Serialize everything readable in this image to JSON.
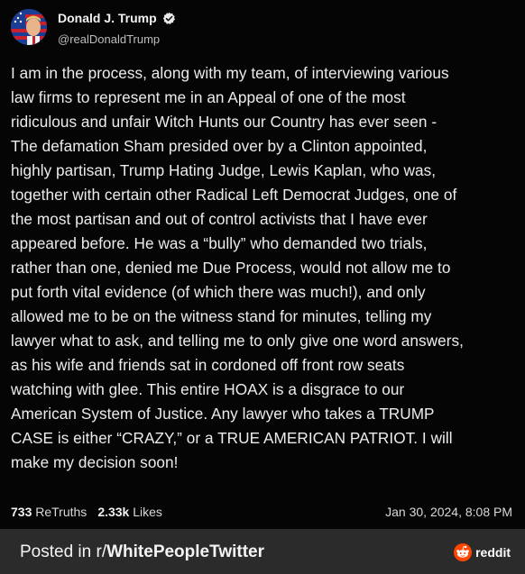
{
  "author": {
    "display_name": "Donald J. Trump",
    "handle": "@realDonaldTrump",
    "avatar_icon": "avatar-flag-portrait-icon",
    "verified_icon": "verified-badge-icon"
  },
  "post": {
    "text": "I am in the process, along with my team, of interviewing various\nlaw firms to represent me in an Appeal of one of the most\nridiculous and unfair Witch Hunts our Country has ever seen -\nThe defamation Sham presided over by a Clinton appointed,\nhighly partisan, Trump Hating Judge, Lewis Kaplan, who was,\ntogether with certain other Radical Left Democrat Judges, one of\nthe most partisan and out of control activists that I have ever\nappeared before. He was a “bully” who demanded two trials,\nrather than one, denied me Due Process, would not allow me to\nput forth vital evidence (of which there was much!), and only\nallowed me to be on the witness stand for minutes, telling my\nlawyer what to ask, and telling me to only give one word answers,\nas his wife and friends sat in cordoned off front row seats\nwatching with glee. This entire HOAX is a disgrace to our\nAmerican System of Justice. Any lawyer who takes a TRUMP\nCASE is either “CRAZY,” or a TRUE AMERICAN PATRIOT. I will\nmake my decision soon!"
  },
  "stats": {
    "retruths_count": "733",
    "retruths_label": "ReTruths",
    "likes_count": "2.33k",
    "likes_label": "Likes",
    "timestamp": "Jan 30, 2024, 8:08 PM"
  },
  "footer": {
    "prefix": "Posted in r/",
    "subreddit": "WhitePeopleTwitter",
    "brand": "reddit",
    "brand_color": "#ff4500",
    "background": "#2b2b2b"
  }
}
